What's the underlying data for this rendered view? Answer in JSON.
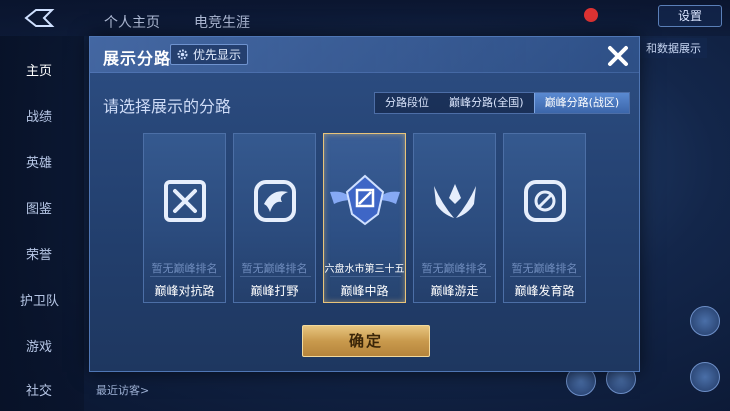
{
  "background": {
    "tabs": [
      "个人主页",
      "电竞生涯"
    ],
    "sidebar": [
      "主页",
      "战绩",
      "英雄",
      "图鉴",
      "荣誉",
      "护卫队",
      "游戏",
      "社交"
    ],
    "top_right_button": "设置",
    "right_banner": "和数据展示",
    "bottom_text": "最近访客>"
  },
  "modal": {
    "title": "展示分路",
    "priority_button": "优先显示",
    "subtitle": "请选择展示的分路",
    "segments": [
      {
        "label": "分路段位",
        "active": false
      },
      {
        "label": "巅峰分路(全国)",
        "active": false
      },
      {
        "label": "巅峰分路(战区)",
        "active": true
      }
    ],
    "cards": [
      {
        "name": "巅峰对抗路",
        "rank": "暂无巅峰排名",
        "icon": "clash-lane-icon",
        "selected": false
      },
      {
        "name": "巅峰打野",
        "rank": "暂无巅峰排名",
        "icon": "jungle-icon",
        "selected": false
      },
      {
        "name": "巅峰中路",
        "rank": "六盘水市第三十五",
        "icon": "mid-lane-icon",
        "selected": true
      },
      {
        "name": "巅峰游走",
        "rank": "暂无巅峰排名",
        "icon": "roam-icon",
        "selected": false
      },
      {
        "name": "巅峰发育路",
        "rank": "暂无巅峰排名",
        "icon": "farm-lane-icon",
        "selected": false
      }
    ],
    "confirm_button": "确定"
  },
  "colors": {
    "modal_bg": "#23406f",
    "accent_gold": "#e7c57f",
    "segment_active": "#3c66aa"
  }
}
